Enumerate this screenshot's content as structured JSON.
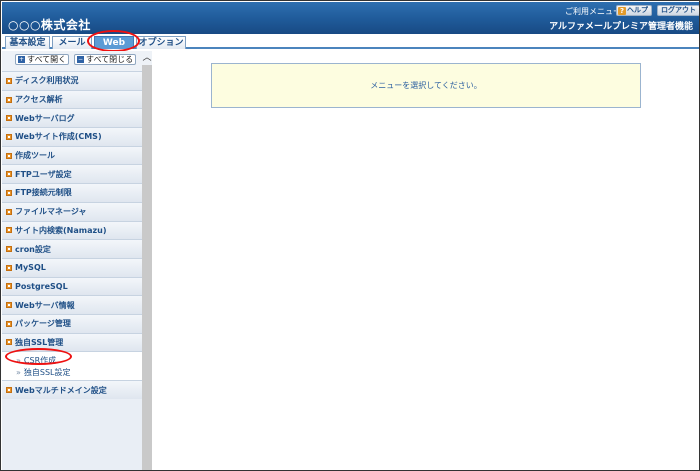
{
  "header": {
    "company": "○○○株式会社",
    "usage_menu": "ご利用メニュー",
    "help_label": "ヘルプ",
    "help_icon": "?",
    "logout_label": "ログアウト",
    "account_name": "アルファメールプレミア管理者機能"
  },
  "tabs": [
    {
      "label": "基本設定"
    },
    {
      "label": "メール"
    },
    {
      "label": "Web",
      "active": true
    },
    {
      "label": "オプション"
    }
  ],
  "sidebar": {
    "expand_all": "すべて開く",
    "collapse_all": "すべて閉じる",
    "expand_icon": "+",
    "collapse_icon": "−",
    "items": [
      {
        "label": "ディスク利用状況"
      },
      {
        "label": "アクセス解析"
      },
      {
        "label": "Webサーバログ"
      },
      {
        "label": "Webサイト作成(CMS)"
      },
      {
        "label": "作成ツール"
      },
      {
        "label": "FTPユーザ設定"
      },
      {
        "label": "FTP接続元制限"
      },
      {
        "label": "ファイルマネージャ"
      },
      {
        "label": "サイト内検索(Namazu)"
      },
      {
        "label": "cron設定"
      },
      {
        "label": "MySQL"
      },
      {
        "label": "PostgreSQL"
      },
      {
        "label": "Webサーバ情報"
      },
      {
        "label": "パッケージ管理"
      },
      {
        "label": "独自SSL管理"
      }
    ],
    "subitems": [
      {
        "label": "CSR作成"
      },
      {
        "label": "独自SSL設定"
      }
    ],
    "last_item": {
      "label": "Webマルチドメイン設定"
    }
  },
  "main": {
    "notice": "メニューを選択してください。"
  },
  "colors": {
    "header": "#1f5a99",
    "active_tab": "#5b9bd5",
    "annotation": "#ee1111",
    "bullet": "#e8942a"
  }
}
